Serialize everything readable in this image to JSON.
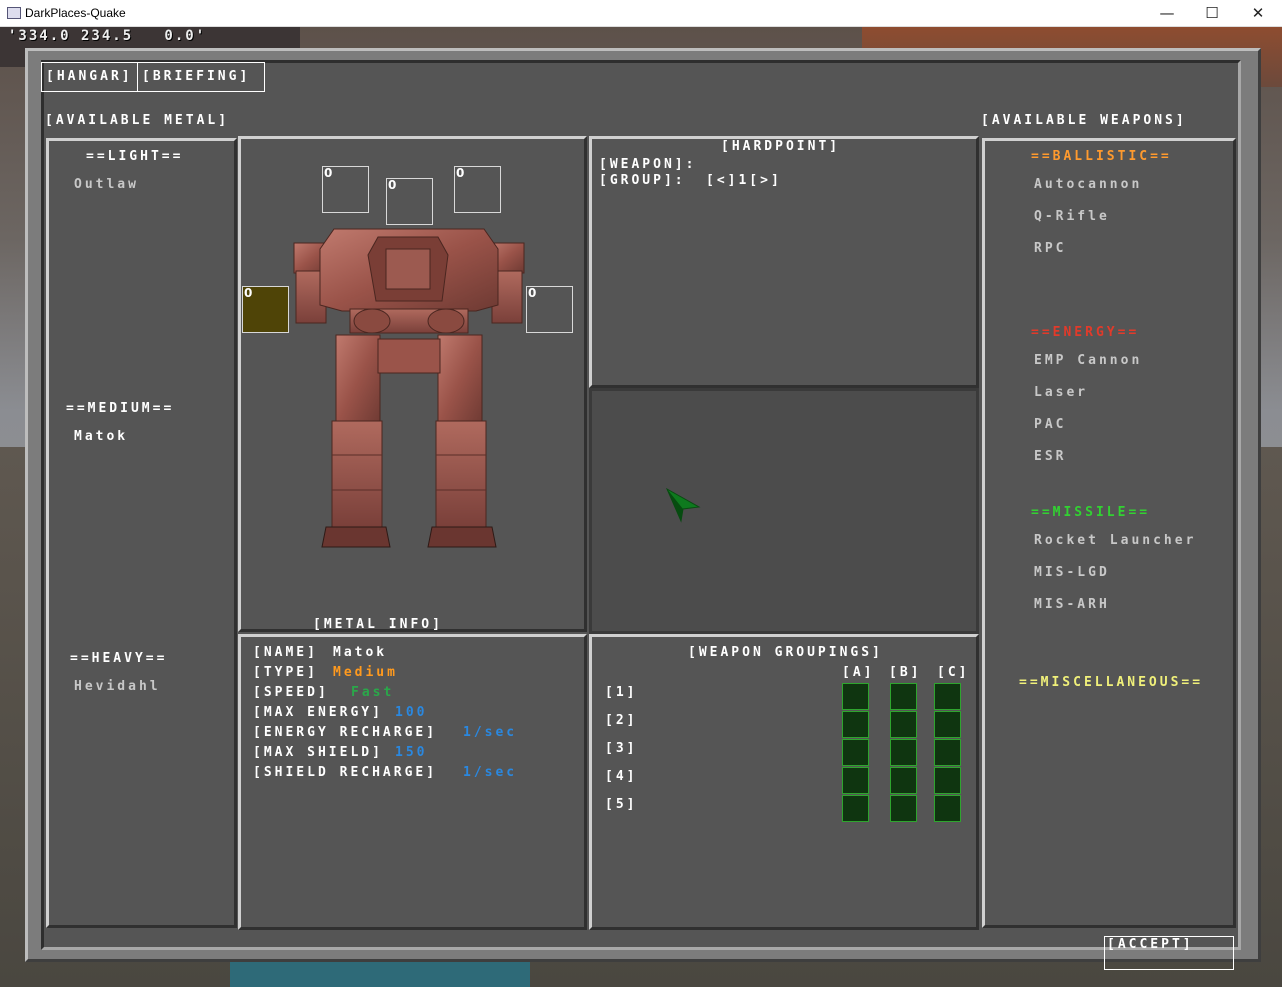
{
  "window": {
    "title": "DarkPlaces-Quake",
    "minimize": "—",
    "maximize": "☐",
    "close": "✕"
  },
  "hud": {
    "coords": "'334.0 234.5   0.0'"
  },
  "tabs": {
    "hangar": "[HANGAR]",
    "briefing": "[BRIEFING]"
  },
  "headers": {
    "available_metal": "[AVAILABLE METAL]",
    "available_weapons": "[AVAILABLE WEAPONS]",
    "metal_info": "[METAL INFO]",
    "hardpoint": "[HARDPOINT]",
    "weapon_groupings": "[WEAPON GROUPINGS]"
  },
  "metal_list": {
    "light_header": "==LIGHT==",
    "light_items": [
      "Outlaw"
    ],
    "medium_header": "==MEDIUM==",
    "medium_items": [
      "Matok"
    ],
    "heavy_header": "==HEAVY==",
    "heavy_items": [
      "Hevidahl"
    ]
  },
  "hardpoint_slots": [
    "0",
    "0",
    "0",
    "0",
    "0"
  ],
  "hardpoint": {
    "weapon_label": "[WEAPON]:",
    "group_label": "[GROUP]:",
    "group_value": "[<]1[>]"
  },
  "metal_info": {
    "name_label": "[NAME]",
    "name_value": "Matok",
    "type_label": "[TYPE]",
    "type_value": "Medium",
    "speed_label": "[SPEED]",
    "speed_value": "Fast",
    "max_energy_label": "[MAX ENERGY]",
    "max_energy_value": "100",
    "energy_recharge_label": "[ENERGY RECHARGE]",
    "energy_recharge_value": "1/sec",
    "max_shield_label": "[MAX SHIELD]",
    "max_shield_value": "150",
    "shield_recharge_label": "[SHIELD RECHARGE]",
    "shield_recharge_value": "1/sec"
  },
  "groupings": {
    "columns": [
      "[A]",
      "[B]",
      "[C]"
    ],
    "rows": [
      "[1]",
      "[2]",
      "[3]",
      "[4]",
      "[5]"
    ]
  },
  "weapons": {
    "ballistic_header": "==BALLISTIC==",
    "ballistic": [
      "Autocannon",
      "Q-Rifle",
      "RPC"
    ],
    "energy_header": "==ENERGY==",
    "energy": [
      "EMP Cannon",
      "Laser",
      "PAC",
      "ESR"
    ],
    "missile_header": "==MISSILE==",
    "missile": [
      "Rocket Launcher",
      "MIS-LGD",
      "MIS-ARH"
    ],
    "misc_header": "==MISCELLANEOUS=="
  },
  "accept": "[ACCEPT]",
  "colors": {
    "ballistic": "#ff9a2e",
    "energy": "#e23a2a",
    "missile": "#32d232",
    "misc": "#f0f07a",
    "type_value": "#ff9a1e",
    "speed_value": "#2aa84a",
    "stat_value": "#2a88e0",
    "selected_slot": "#4f4407"
  }
}
